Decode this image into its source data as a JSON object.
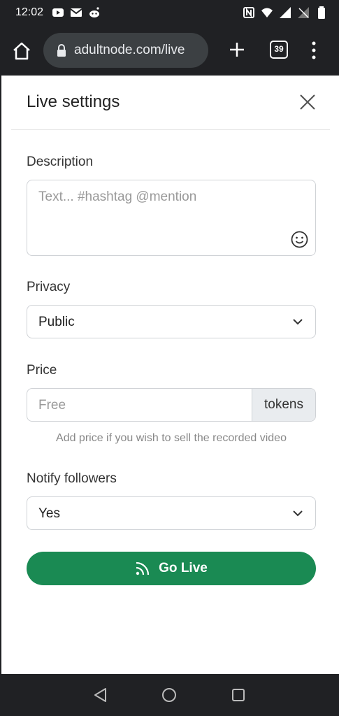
{
  "status_bar": {
    "time": "12:02",
    "left_icons": [
      "youtube-icon",
      "gmail-icon",
      "reddit-icon"
    ],
    "right_icons": [
      "nfc-icon",
      "wifi-icon",
      "signal-icon",
      "no-sim-icon",
      "battery-icon"
    ]
  },
  "browser": {
    "url": "adultnode.com/live",
    "tab_count": "39"
  },
  "header": {
    "title": "Live settings"
  },
  "form": {
    "description": {
      "label": "Description",
      "placeholder": "Text... #hashtag @mention"
    },
    "privacy": {
      "label": "Privacy",
      "value": "Public"
    },
    "price": {
      "label": "Price",
      "placeholder": "Free",
      "addon": "tokens",
      "help": "Add price if you wish to sell the recorded video"
    },
    "notify": {
      "label": "Notify followers",
      "value": "Yes"
    },
    "submit_label": "Go Live"
  },
  "colors": {
    "accent": "#1a8a53",
    "chrome": "#202124"
  }
}
